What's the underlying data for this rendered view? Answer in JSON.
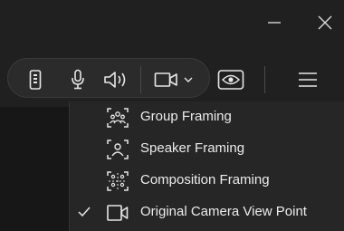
{
  "window_controls": {
    "minimize_icon": "minimize-icon",
    "close_icon": "close-icon"
  },
  "toolbar": {
    "icons": [
      "remote-icon",
      "microphone-icon",
      "speaker-icon",
      "camera-icon",
      "chevron-down-icon",
      "eye-icon",
      "hamburger-menu-icon"
    ],
    "camera_dropdown_expanded": true
  },
  "framing_menu": {
    "items": [
      {
        "label": "Group Framing",
        "icon": "group-framing-icon",
        "checked": false
      },
      {
        "label": "Speaker Framing",
        "icon": "speaker-framing-icon",
        "checked": false
      },
      {
        "label": "Composition Framing",
        "icon": "composition-framing-icon",
        "checked": false
      },
      {
        "label": "Original Camera View Point",
        "icon": "camera-view-icon",
        "checked": true
      }
    ]
  },
  "colors": {
    "background": "#1e1e1e",
    "toolbar": "#202020",
    "menu": "#262626",
    "icon": "#e6e6e6"
  }
}
